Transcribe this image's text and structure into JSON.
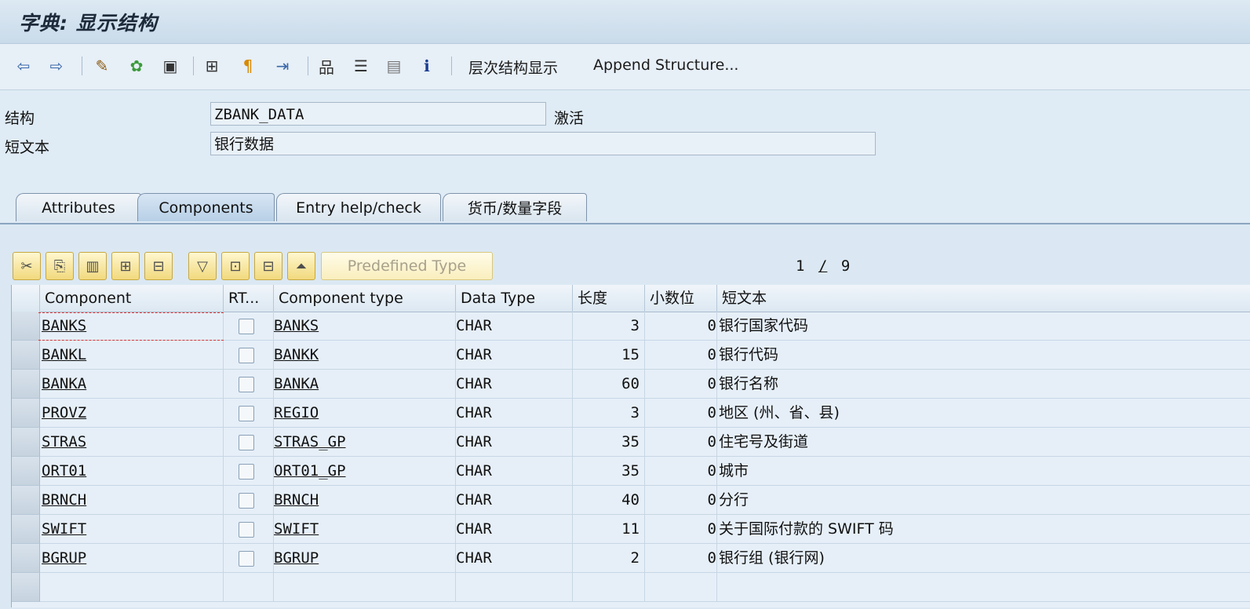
{
  "window": {
    "title": "字典: 显示结构"
  },
  "toolbar": {
    "icons": [
      "back-arrow-icon",
      "forward-arrow-icon",
      "other-object-icon",
      "display-change-icon",
      "activate-icon",
      "where-used-icon",
      "object-list-icon",
      "navigation-window-icon",
      "hierarchy-icon",
      "stack-icon",
      "documentation-icon",
      "info-icon"
    ],
    "hierarchy_label": "层次结构显示",
    "append_label": "Append Structure..."
  },
  "header": {
    "structure_label": "结构",
    "structure_value": "ZBANK_DATA",
    "status": "激活",
    "short_text_label": "短文本",
    "short_text_value": "银行数据"
  },
  "tabs": [
    {
      "label": "Attributes",
      "active": false
    },
    {
      "label": "Components",
      "active": true
    },
    {
      "label": "Entry help/check",
      "active": false
    },
    {
      "label": "货币/数量字段",
      "active": false
    }
  ],
  "grid_toolbar": {
    "predefined_type_label": "Predefined Type",
    "page_current": "1",
    "page_sep": "/",
    "page_total": "9"
  },
  "table": {
    "columns": [
      "Component",
      "RT...",
      "Component type",
      "Data Type",
      "长度",
      "小数位",
      "短文本"
    ],
    "rows": [
      {
        "component": "BANKS",
        "type": "BANKS",
        "dtype": "CHAR",
        "length": "3",
        "decimals": "0",
        "text": "银行国家代码"
      },
      {
        "component": "BANKL",
        "type": "BANKK",
        "dtype": "CHAR",
        "length": "15",
        "decimals": "0",
        "text": "银行代码"
      },
      {
        "component": "BANKA",
        "type": "BANKA",
        "dtype": "CHAR",
        "length": "60",
        "decimals": "0",
        "text": "银行名称"
      },
      {
        "component": "PROVZ",
        "type": "REGIO",
        "dtype": "CHAR",
        "length": "3",
        "decimals": "0",
        "text": "地区 (州、省、县)"
      },
      {
        "component": "STRAS",
        "type": "STRAS_GP",
        "dtype": "CHAR",
        "length": "35",
        "decimals": "0",
        "text": "住宅号及街道"
      },
      {
        "component": "ORT01",
        "type": "ORT01_GP",
        "dtype": "CHAR",
        "length": "35",
        "decimals": "0",
        "text": "城市"
      },
      {
        "component": "BRNCH",
        "type": "BRNCH",
        "dtype": "CHAR",
        "length": "40",
        "decimals": "0",
        "text": "分行"
      },
      {
        "component": "SWIFT",
        "type": "SWIFT",
        "dtype": "CHAR",
        "length": "11",
        "decimals": "0",
        "text": "关于国际付款的 SWIFT 码"
      },
      {
        "component": "BGRUP",
        "type": "BGRUP",
        "dtype": "CHAR",
        "length": "2",
        "decimals": "0",
        "text": "银行组 (银行网)"
      }
    ]
  }
}
